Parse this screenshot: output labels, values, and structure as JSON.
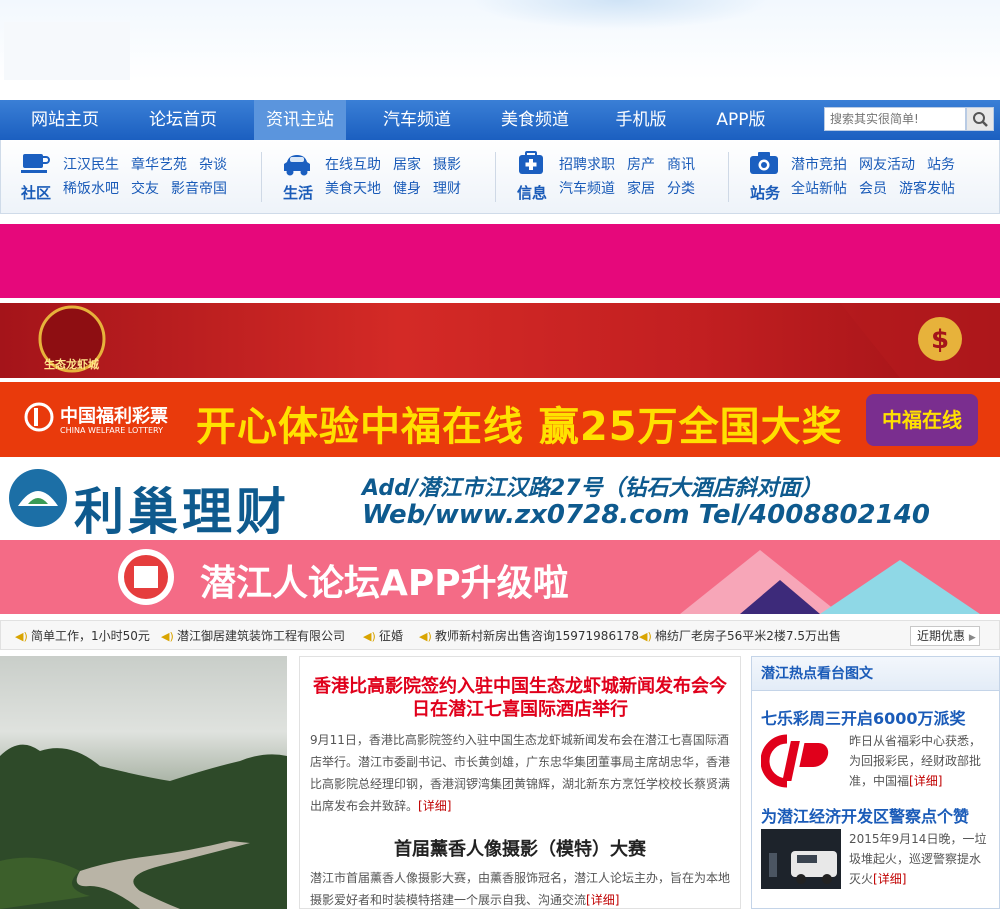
{
  "nav": {
    "items": [
      "网站主页",
      "论坛首页",
      "资讯主站",
      "汽车频道",
      "美食频道",
      "手机版",
      "APP版"
    ],
    "active_index": 2,
    "search_placeholder": "搜索其实很简单!"
  },
  "subnav": {
    "groups": [
      {
        "title": "社区",
        "icon": "cup-icon",
        "row1": [
          "江汉民生",
          "章华艺苑",
          "杂谈"
        ],
        "row2": [
          "稀饭水吧",
          "交友",
          "影音帝国"
        ]
      },
      {
        "title": "生活",
        "icon": "car-icon",
        "row1": [
          "在线互助",
          "居家",
          "摄影"
        ],
        "row2": [
          "美食天地",
          "健身",
          "理财"
        ]
      },
      {
        "title": "信息",
        "icon": "medkit-icon",
        "row1": [
          "招聘求职",
          "房产",
          "商讯"
        ],
        "row2": [
          "汽车频道",
          "家居",
          "分类"
        ]
      },
      {
        "title": "站务",
        "icon": "camera-icon",
        "row1": [
          "潜市竞拍",
          "网友活动",
          "站务"
        ],
        "row2": [
          "全站新帖",
          "会员",
          "游客发帖"
        ]
      }
    ]
  },
  "banners": {
    "b2_logo": "生态龙虾城",
    "b3": {
      "logo": "中国福利彩票",
      "logo_en": "CHINA WELFARE LOTTERY",
      "text": "开心体验中福在线  赢25万全国大奖",
      "badge": "中福在线"
    },
    "b4": {
      "title": "利巢理财",
      "line1": "Add/潜江市江汉路27号（钻石大酒店斜对面）",
      "line2": "Web/www.zx0728.com  Tel/4008802140"
    },
    "b5": {
      "text": "潜江人论坛APP升级啦"
    }
  },
  "ticker": {
    "items": [
      "简单工作，1小时50元",
      "潜江御居建筑装饰工程有限公司",
      "征婚",
      "教师新村新房出售咨询15971986178",
      "棉纺厂老房子56平米2楼7.5万出售"
    ],
    "recent_button": "近期优惠"
  },
  "news": {
    "headline1": "香港比高影院签约入驻中国生态龙虾城新闻发布会今日在潜江七喜国际酒店举行",
    "summary1": "9月11日，香港比高影院签约入驻中国生态龙虾城新闻发布会在潜江七喜国际酒店举行。潜江市委副书记、市长黄剑雄，广东忠华集团董事局主席胡忠华，香港比高影院总经理印钢，香港润锣湾集团黄锦辉，湖北新东方烹饪学校校长蔡贤满出席发布会并致辞。",
    "detail_label": "[详细]",
    "headline2": "首届薰香人像摄影（模特）大赛",
    "summary2": "潜江市首届薰香人像摄影大赛，由薰香服饰冠名，潜江人论坛主办，旨在为本地摄影爱好者和时装模特搭建一个展示自我、沟通交流"
  },
  "side": {
    "header": "潜江热点看台图文",
    "items": [
      {
        "title": "七乐彩周三开启6000万派奖",
        "text": "昨日从省福彩中心获悉，为回报彩民，经财政部批准，中国福"
      },
      {
        "title": "为潜江经济开发区警察点个赞",
        "text": "2015年9月14日晚，一垃圾堆起火，巡逻警察提水灭火"
      }
    ]
  },
  "colors": {
    "nav_blue": "#1b5fc0",
    "link_blue": "#1a5bb8",
    "headline_red": "#e0001b",
    "banner_pink": "#e6087b",
    "banner_red": "#c21f21",
    "banner_orange": "#e93a0c",
    "banner_teal": "#0e5a8e"
  }
}
